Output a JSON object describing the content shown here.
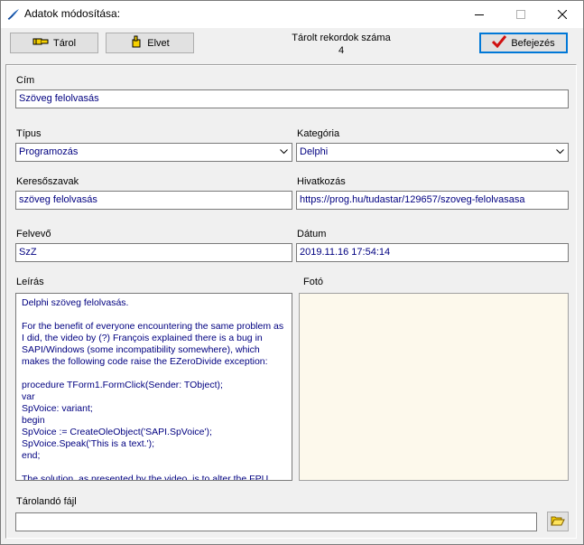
{
  "window": {
    "title": "Adatok módosítása:",
    "icon": "feather-app-icon"
  },
  "toolbar": {
    "store_label": "Tárol",
    "discard_label": "Elvet",
    "record_count_label": "Tárolt rekordok száma",
    "record_count_value": "4",
    "finish_label": "Befejezés"
  },
  "form": {
    "title_label": "Cím",
    "title_value": "Szöveg felolvasás",
    "type_label": "Típus",
    "type_value": "Programozás",
    "category_label": "Kategória",
    "category_value": "Delphi",
    "keywords_label": "Keresőszavak",
    "keywords_value": "szöveg felolvasás",
    "link_label": "Hivatkozás",
    "link_value": "https://prog.hu/tudastar/129657/szoveg-felolvasasa",
    "recorder_label": "Felvevő",
    "recorder_value": "SzZ",
    "date_label": "Dátum",
    "date_value": "2019.11.16 17:54:14",
    "description_label": "Leírás",
    "description_value": "Delphi szöveg felolvasás.\n\nFor the benefit of everyone encountering the same problem as I did, the video by (?) François explained there is a bug in SAPI/Windows (some incompatibility somewhere), which makes the following code raise the EZeroDivide exception:\n\nprocedure TForm1.FormClick(Sender: TObject);\nvar\nSpVoice: variant;\nbegin\nSpVoice := CreateOleObject('SAPI.SpVoice');\nSpVoice.Speak('This is a text.');\nend;\n\nThe solution, as presented by the video, is to alter the FPU",
    "photo_label": "Fotó",
    "file_label": "Tárolandó fájl",
    "file_value": ""
  },
  "colors": {
    "field_text": "#000080",
    "photo_bg": "#fdf9ec",
    "default_button_border": "#0078d7"
  }
}
